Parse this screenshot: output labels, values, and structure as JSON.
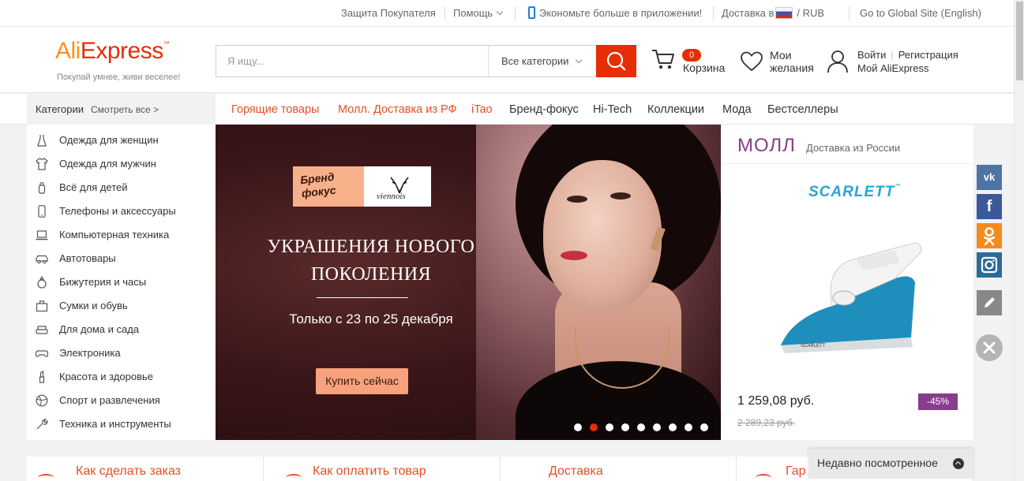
{
  "topbar": {
    "buyer_protection": "Защита Покупателя",
    "help": "Помощь",
    "app_promo": "Экономьте больше в приложении!",
    "ship_to": "Доставка в",
    "currency_sep": "/",
    "currency": "RUB",
    "global_site": "Go to Global Site (English)"
  },
  "header": {
    "logo_ali": "Ali",
    "logo_express": "Express",
    "logo_tm": "™",
    "tagline": "Покупай умнее, живи веселее!",
    "search_placeholder": "Я ищу...",
    "search_category": "Все категории",
    "cart_count": "0",
    "cart_label": "Корзина",
    "wishlist_label": "Мои желания",
    "login": "Войти",
    "register": "Регистрация",
    "my_account": "Мой AliExpress"
  },
  "nav": {
    "categories": "Категории",
    "see_all": "Смотреть все >",
    "links": [
      {
        "label": "Горящие товары",
        "hot": true
      },
      {
        "label": "Молл. Доставка из РФ",
        "hot": true
      },
      {
        "label": "iTao",
        "hot": true
      },
      {
        "label": "Бренд-фокус",
        "hot": false
      },
      {
        "label": "Hi-Tech",
        "hot": false
      },
      {
        "label": "Коллекции",
        "hot": false
      },
      {
        "label": "Мода",
        "hot": false
      },
      {
        "label": "Бестселлеры",
        "hot": false
      }
    ]
  },
  "categories": [
    {
      "label": "Одежда для женщин",
      "icon": "dress-icon"
    },
    {
      "label": "Одежда для мужчин",
      "icon": "shirt-icon"
    },
    {
      "label": "Всё для детей",
      "icon": "baby-bottle-icon"
    },
    {
      "label": "Телефоны и аксессуары",
      "icon": "phone-icon"
    },
    {
      "label": "Компьютерная техника",
      "icon": "laptop-icon"
    },
    {
      "label": "Автотовары",
      "icon": "car-icon"
    },
    {
      "label": "Бижутерия и часы",
      "icon": "ring-icon"
    },
    {
      "label": "Сумки и обувь",
      "icon": "bag-icon"
    },
    {
      "label": "Для дома и сада",
      "icon": "sofa-icon"
    },
    {
      "label": "Электроника",
      "icon": "gamepad-icon"
    },
    {
      "label": "Красота и здоровье",
      "icon": "lipstick-icon"
    },
    {
      "label": "Спорт и развлечения",
      "icon": "ball-icon"
    },
    {
      "label": "Техника и инструменты",
      "icon": "tools-icon"
    }
  ],
  "hero": {
    "brand_focus": "Бренд\nфокус",
    "brand_name": "viennois",
    "title": "УКРАШЕНИЯ НОВОГО ПОКОЛЕНИЯ",
    "subtitle": "Только с 23 по 25 декабря",
    "cta": "Купить сейчас",
    "slide_count": 9,
    "active_slide": 2
  },
  "mall": {
    "title": "МОЛЛ",
    "subtitle": "Доставка из России",
    "brand": "SCARLETT",
    "brand_tm": "™",
    "price": "1 259,08 руб.",
    "discount": "-45%",
    "old_price": "2 289,23 руб."
  },
  "info": [
    {
      "label": "Как сделать заказ"
    },
    {
      "label": "Как оплатить товар"
    },
    {
      "label": "Доставка"
    },
    {
      "label": "Гар"
    }
  ],
  "recent": {
    "label": "Недавно посмотренное"
  },
  "colors": {
    "accent": "#e62e04",
    "hot_link": "#e64f24",
    "mall_purple": "#8a3c8c"
  }
}
